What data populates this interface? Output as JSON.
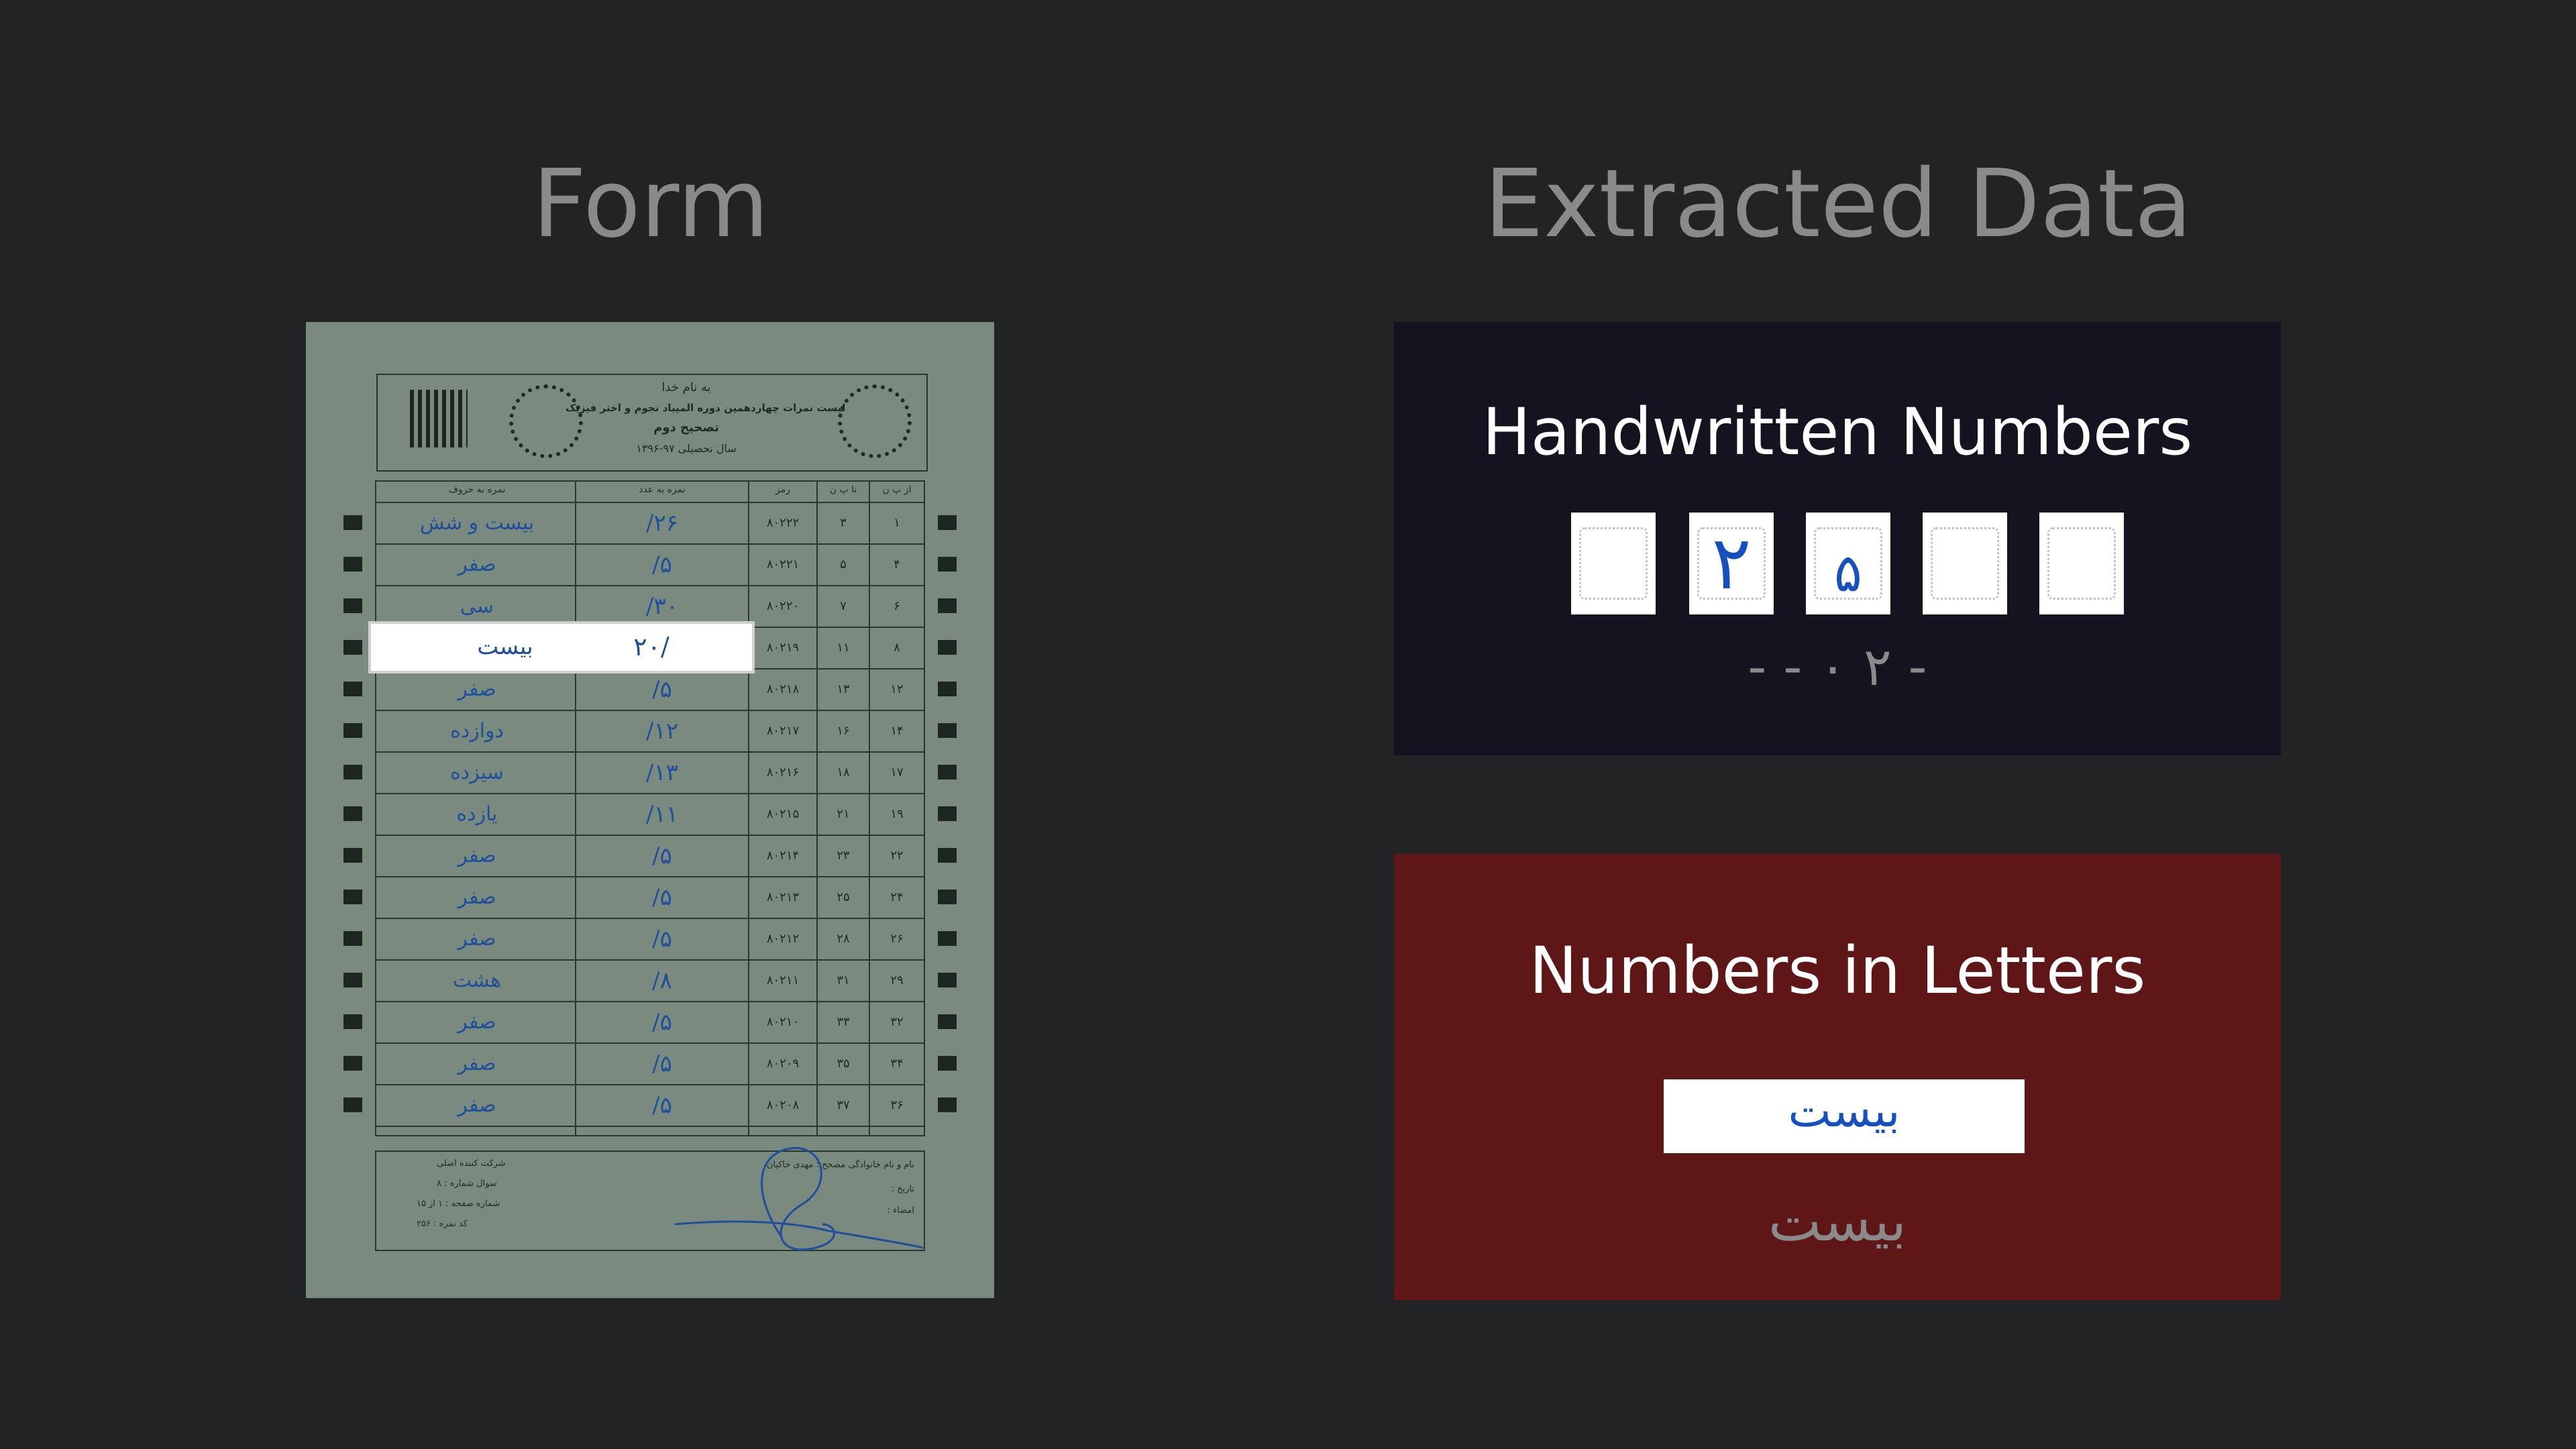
{
  "headings": {
    "form": "Form",
    "extracted": "Extracted Data"
  },
  "form": {
    "salutation": "به نام خدا",
    "title": "لیست نمرات چهاردهمین دوره المپیاد نجوم و اختر فیزیک",
    "subtitle": "تصحیح دوم",
    "year": "سال تحصیلی ۹۷-۱۳۹۶",
    "columns": [
      "از پ ن",
      "تا پ ن",
      "رمز",
      "نمره به عدد",
      "نمره به حروف"
    ],
    "rows": [
      {
        "from": "۱",
        "to": "۳",
        "code": "۸۰۲۲۲",
        "number": "۲۶/",
        "word": "بیست و شش"
      },
      {
        "from": "۴",
        "to": "۵",
        "code": "۸۰۲۲۱",
        "number": "۵/",
        "word": "صفر"
      },
      {
        "from": "۶",
        "to": "۷",
        "code": "۸۰۲۲۰",
        "number": "۳۰/",
        "word": "سی"
      },
      {
        "from": "۸",
        "to": "۱۱",
        "code": "۸۰۲۱۹",
        "number": "۲۰/",
        "word": "بیست"
      },
      {
        "from": "۱۲",
        "to": "۱۳",
        "code": "۸۰۲۱۸",
        "number": "۵/",
        "word": "صفر"
      },
      {
        "from": "۱۴",
        "to": "۱۶",
        "code": "۸۰۲۱۷",
        "number": "۱۲/",
        "word": "دوازده"
      },
      {
        "from": "۱۷",
        "to": "۱۸",
        "code": "۸۰۲۱۶",
        "number": "۱۳/",
        "word": "سیزده"
      },
      {
        "from": "۱۹",
        "to": "۲۱",
        "code": "۸۰۲۱۵",
        "number": "۱۱/",
        "word": "یازده"
      },
      {
        "from": "۲۲",
        "to": "۲۳",
        "code": "۸۰۲۱۴",
        "number": "۵/",
        "word": "صفر"
      },
      {
        "from": "۲۴",
        "to": "۲۵",
        "code": "۸۰۲۱۳",
        "number": "۵/",
        "word": "صفر"
      },
      {
        "from": "۲۶",
        "to": "۲۸",
        "code": "۸۰۲۱۲",
        "number": "۵/",
        "word": "صفر"
      },
      {
        "from": "۲۹",
        "to": "۳۱",
        "code": "۸۰۲۱۱",
        "number": "۸/",
        "word": "هشت"
      },
      {
        "from": "۳۲",
        "to": "۳۳",
        "code": "۸۰۲۱۰",
        "number": "۵/",
        "word": "صفر"
      },
      {
        "from": "۳۴",
        "to": "۳۵",
        "code": "۸۰۲۰۹",
        "number": "۵/",
        "word": "صفر"
      },
      {
        "from": "۳۶",
        "to": "۳۷",
        "code": "۸۰۲۰۸",
        "number": "۵/",
        "word": "صفر"
      }
    ],
    "highlighted_row_index": 3,
    "footer": {
      "examiner": "نام و نام خانوادگی مصحح : مهدی خاکیان",
      "date": "تاریخ :",
      "signature": "امضاء :",
      "company": "شرکت کننده اصلی",
      "question": "سوال شماره : ۸",
      "page": "شماره صفحه : ۱ از ۱۵",
      "grade_code": "کد نمره : ۲۵۶"
    }
  },
  "handwritten_panel": {
    "title": "Handwritten Numbers",
    "boxes": [
      "",
      "۲",
      "۵",
      "",
      ""
    ],
    "extracted_text": "- ۲ ۰ - -",
    "bg_color": "#141421"
  },
  "letters_panel": {
    "title": "Numbers in Letters",
    "handwritten_word": "بیست",
    "extracted_text": "بیست",
    "bg_color": "#5f1616"
  }
}
